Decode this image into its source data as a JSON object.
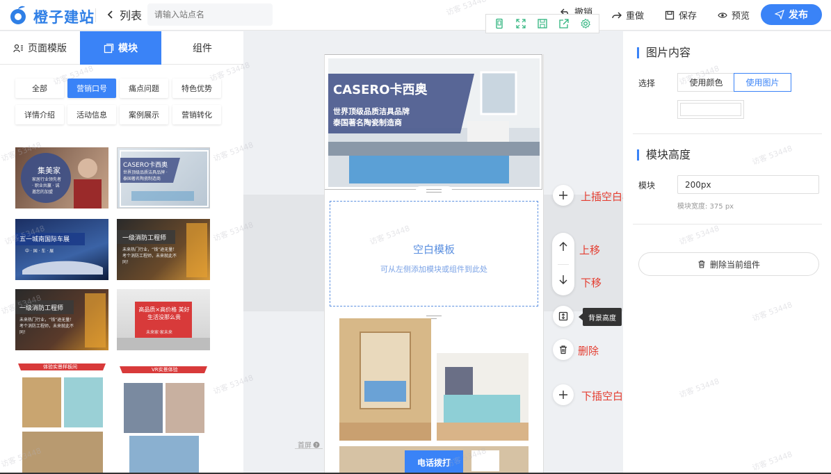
{
  "app": {
    "brand": "橙子建站",
    "back_label": "列表",
    "site_placeholder": "请输入站点名"
  },
  "toolbar": {
    "undo": "撤销",
    "redo": "重做",
    "save": "保存",
    "preview": "预览",
    "publish": "发布"
  },
  "left": {
    "tabs": [
      {
        "label": "页面模版"
      },
      {
        "label": "模块"
      },
      {
        "label": "组件"
      }
    ],
    "categories": [
      "全部",
      "营销口号",
      "痛点问题",
      "特色优势",
      "详情介绍",
      "活动信息",
      "案例展示",
      "营销转化"
    ],
    "thumbs": [
      {
        "title": "集美家",
        "sub": "家居行业领先者 · 职业共赢 · 诚邀您的加盟"
      },
      {
        "title": "CASERO卡西奥",
        "sub": "世界顶级品质洁具品牌 · 泰国著名陶瓷制造商"
      },
      {
        "title": "五一城南国际车展",
        "sub": "中 · 国 · 车 · 展"
      },
      {
        "title": "一级消防工程师",
        "sub": "未来热门行业，“钱”途无量！考个消防工程师，未来就此不同！"
      },
      {
        "title": "一级消防工程师",
        "sub": "未来热门行业，“钱”途无量！考个消防工程师，未来就此不同！"
      },
      {
        "title": "高品质×高价格 美好生活没那么贵",
        "sub": "未来家·家未来"
      },
      {
        "title": "体验实景样板间",
        "sub": ""
      },
      {
        "title": "VR实景体验",
        "sub": ""
      }
    ]
  },
  "canvas": {
    "hero_title": "CASERO卡西奥",
    "hero_line1": "世界顶级品质洁具品牌",
    "hero_line2": "泰国著名陶瓷制造商",
    "blank_title": "空白模板",
    "blank_sub": "可从左侧添加模块或组件到此处",
    "call_button": "电话拨打",
    "first_screen": "首屏"
  },
  "side_tools": {
    "insert_above": "上插空白模块",
    "move_up": "上移",
    "move_down": "下移",
    "bg_height_tip": "背景高度",
    "delete": "删除",
    "insert_below": "下插空白模块"
  },
  "right": {
    "image_section": "图片内容",
    "select_label": "选择",
    "use_color": "使用颜色",
    "use_image": "使用图片",
    "height_section": "模块高度",
    "height_label": "模块",
    "height_value": "200px",
    "width_hint": "模块宽度: 375 px",
    "delete_component": "删除当前组件"
  },
  "watermark": "访客 53448",
  "colors": {
    "accent": "#3a83f7",
    "annotation": "#e43c2f"
  }
}
